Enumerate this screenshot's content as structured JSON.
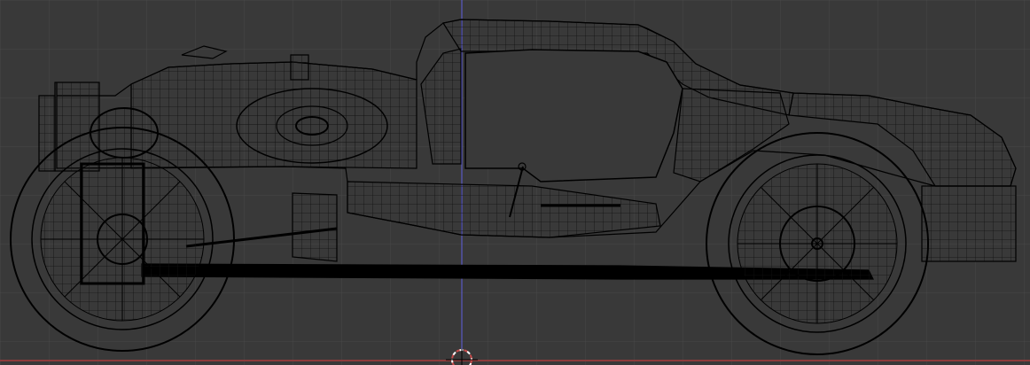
{
  "viewport": {
    "title": "",
    "mode": "wireframe",
    "view": "side-orthographic",
    "colors": {
      "background": "#393939",
      "grid": "#474747",
      "wire": "#000000",
      "x_axis": "#8d3b3b",
      "z_axis": "#5f5fe0",
      "cursor_red": "#c84a4a",
      "cursor_white": "#ffffff"
    }
  }
}
